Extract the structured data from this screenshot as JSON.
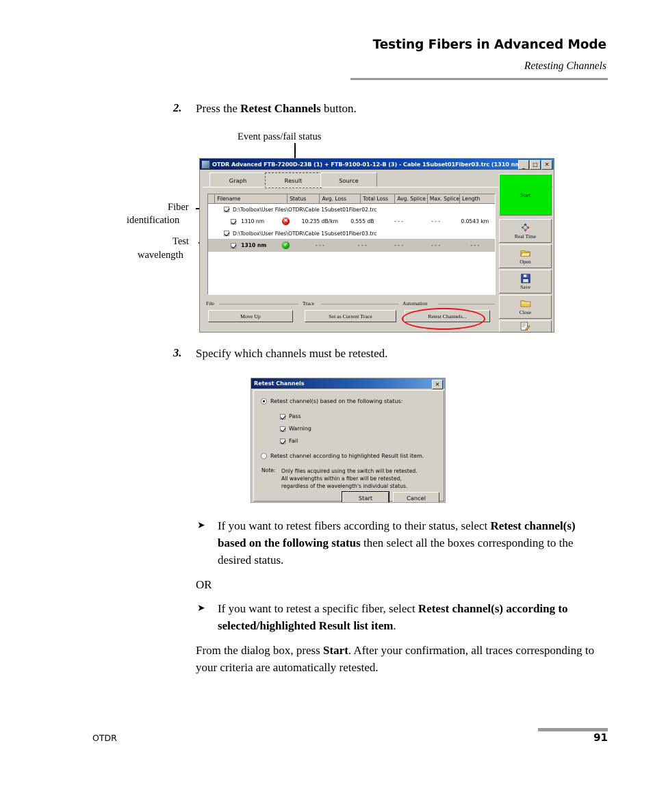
{
  "header": {
    "title": "Testing Fibers in Advanced Mode",
    "subtitle": "Retesting Channels"
  },
  "footer": {
    "label": "OTDR",
    "page": "91"
  },
  "steps": {
    "step2_num": "2.",
    "step2_text_before": "Press the ",
    "step2_text_bold": "Retest Channels",
    "step2_text_after": " button.",
    "step3_num": "3.",
    "step3_text": "Specify which channels must be retested."
  },
  "callouts": {
    "event_status": "Event pass/fail status",
    "fiber_line1": "Fiber",
    "fiber_line2": "identification",
    "test_line1": "Test",
    "test_line2": "wavelength"
  },
  "otdr_window": {
    "title": "OTDR Advanced FTB-7200D-23B (1) + FTB-9100-01-12-B (3) - Cable 1Subset01Fiber03.trc (1310 nm)",
    "window_buttons": {
      "minimize": "_",
      "maximize": "□",
      "close": "✕"
    },
    "tabs": [
      {
        "label": "Graph",
        "selected": false
      },
      {
        "label": "Result",
        "selected": true
      },
      {
        "label": "Source",
        "selected": false
      }
    ],
    "table": {
      "columns": [
        "Filename",
        "Status",
        "Avg. Loss",
        "Total Loss",
        "Avg. Splice",
        "Max. Splice",
        "Length"
      ],
      "rows": [
        {
          "type": "fiber",
          "checked": true,
          "filename": "D:\\Toolbox\\User Files\\OTDR\\Cable 1Subset01Fiber02.trc",
          "highlighted": false
        },
        {
          "type": "wavelength",
          "checked": true,
          "wavelength": "1310 nm",
          "status": "fail",
          "avg_loss": "10.235 dB/km",
          "total_loss": "0.555 dB",
          "avg_splice": "- - -",
          "max_splice": "- - -",
          "length": "0.0543 km",
          "highlighted": false
        },
        {
          "type": "fiber",
          "checked": true,
          "filename": "D:\\Toolbox\\User Files\\OTDR\\Cable 1Subset01Fiber03.trc",
          "highlighted": false
        },
        {
          "type": "wavelength",
          "checked": true,
          "wavelength": "1310 nm",
          "status": "pass",
          "avg_loss": "- - -",
          "total_loss": "- - -",
          "avg_splice": "- - -",
          "max_splice": "- - -",
          "length": "- - -",
          "highlighted": true
        }
      ]
    },
    "groups": {
      "file_label": "File",
      "file_button": "Move Up",
      "trace_label": "Trace",
      "trace_button": "Set as Current Trace",
      "automation_label": "Automation",
      "automation_button": "Retest Channels..."
    },
    "sidebar": [
      {
        "label": "Start",
        "icon": "start-indicator",
        "accent": "#00e800"
      },
      {
        "label": "Real Time",
        "icon": "realtime-arrows-icon"
      },
      {
        "label": "Open",
        "icon": "open-folder-icon"
      },
      {
        "label": "Save",
        "icon": "floppy-disk-icon"
      },
      {
        "label": "Close",
        "icon": "close-folder-icon"
      },
      {
        "label": "",
        "icon": "report-edit-icon"
      }
    ],
    "highlight_color": "#ee1111"
  },
  "dialog": {
    "title": "Retest Channels",
    "close_glyph": "✕",
    "option_status": {
      "label": "Retest channel(s) based on the following status:",
      "selected": true
    },
    "checkboxes": [
      {
        "label": "Pass",
        "checked": true
      },
      {
        "label": "Warning",
        "checked": true
      },
      {
        "label": "Fail",
        "checked": true
      }
    ],
    "option_highlighted": {
      "label": "Retest channel according to highlighted Result list item.",
      "selected": false
    },
    "note_label": "Note:",
    "note_text": "Only files acquired using the switch will be retested. All wavelengths within a fiber will be retested, regardless of the wavelength's individual status.",
    "buttons": {
      "start": "Start",
      "cancel": "Cancel"
    }
  },
  "bullets": {
    "arrow": "➤",
    "b1_p1": "If you want to retest fibers according to their status, select ",
    "b1_b1": "Retest channel(s) based on the following status",
    "b1_p2": " then select all the boxes corresponding to the desired status.",
    "or": "OR",
    "b2_p1": "If you want to retest a specific fiber, select ",
    "b2_b1": "Retest channel(s) according to selected/highlighted Result list item",
    "b2_p2": ".",
    "final_p1": "From the dialog box, press ",
    "final_b1": "Start",
    "final_p2": ". After your confirmation, all traces corresponding to your criteria are automatically retested."
  }
}
